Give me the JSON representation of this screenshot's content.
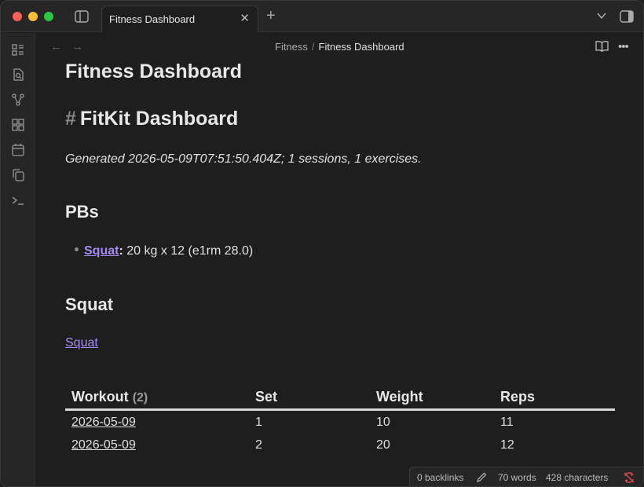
{
  "tab": {
    "title": "Fitness Dashboard"
  },
  "breadcrumb": {
    "parent": "Fitness",
    "separator": "/",
    "current": "Fitness Dashboard"
  },
  "note": {
    "title": "Fitness Dashboard",
    "heading_hash": "#",
    "heading": "FitKit Dashboard",
    "generated": "Generated 2026-05-09T07:51:50.404Z; 1 sessions, 1 exercises.",
    "pbs_heading": "PBs",
    "pb_item": {
      "link": "Squat",
      "colon": ":",
      "text": " 20 kg x 12 (e1rm 28.0)"
    },
    "squat_heading": "Squat",
    "squat_link": "Squat"
  },
  "table": {
    "headers": {
      "workout": "Workout",
      "workout_count": "(2)",
      "set": "Set",
      "weight": "Weight",
      "reps": "Reps"
    },
    "rows": [
      {
        "workout": "2026-05-09",
        "set": "1",
        "weight": "10",
        "reps": "11"
      },
      {
        "workout": "2026-05-09",
        "set": "2",
        "weight": "20",
        "reps": "12"
      }
    ]
  },
  "status": {
    "backlinks": "0 backlinks",
    "words": "70 words",
    "characters": "428 characters"
  },
  "icons": {
    "ribbon": [
      "files-icon",
      "search-file-icon",
      "graph-icon",
      "canvas-icon",
      "calendar-icon",
      "copy-icon",
      "terminal-icon"
    ]
  },
  "colors": {
    "accent": "#a48cf0",
    "background": "#1e1e1e",
    "sync_error": "#e5484d"
  }
}
